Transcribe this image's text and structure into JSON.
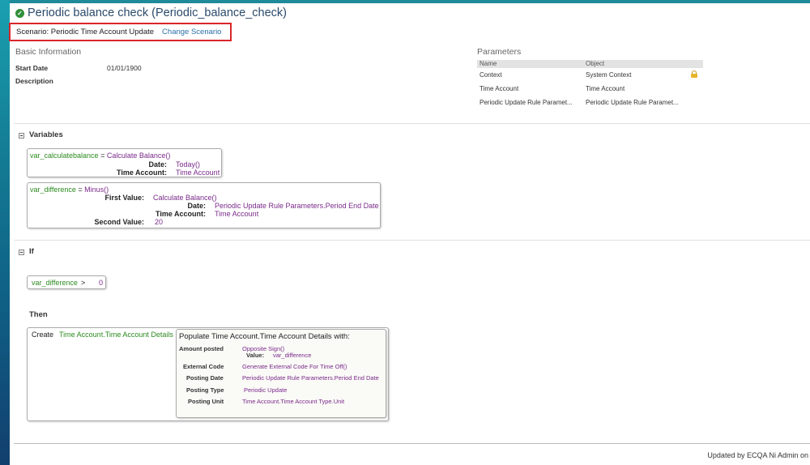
{
  "header": {
    "title": "Periodic balance check (Periodic_balance_check)",
    "status_icon": "check-circle-icon"
  },
  "scenario": {
    "label": "Scenario: Periodic Time Account Update",
    "change_link": "Change Scenario"
  },
  "basic_info": {
    "heading": "Basic Information",
    "start_date_label": "Start Date",
    "start_date_value": "01/01/1900",
    "description_label": "Description"
  },
  "parameters": {
    "heading": "Parameters",
    "columns": [
      "Name",
      "Object"
    ],
    "rows": [
      {
        "name": "Context",
        "object": "System Context",
        "locked": true
      },
      {
        "name": "Time Account",
        "object": "Time Account",
        "locked": false
      },
      {
        "name": "Periodic Update Rule Paramet...",
        "object": "Periodic Update Rule Paramet...",
        "locked": false
      }
    ]
  },
  "variables": {
    "title": "Variables",
    "var1": {
      "name": "var_calculatebalance",
      "eq": "=",
      "func": "Calculate Balance()",
      "date_label": "Date:",
      "date_value": "Today()",
      "account_label": "Time Account:",
      "account_value": "Time Account"
    },
    "var2": {
      "name": "var_difference",
      "eq": "=",
      "func": "Minus()",
      "first_label": "First Value:",
      "first_value": "Calculate Balance()",
      "date_label": "Date:",
      "date_value": "Periodic Update Rule Parameters.Period End Date",
      "account_label": "Time Account:",
      "account_value": "Time Account",
      "second_label": "Second Value:",
      "second_value": "20"
    }
  },
  "if_section": {
    "title": "If",
    "condition_var": "var_difference",
    "condition_op": ">",
    "condition_value": "0"
  },
  "then_section": {
    "title": "Then",
    "create_label": "Create",
    "create_target": "Time Account.Time Account Details",
    "populate_title": "Populate Time Account.Time Account Details with:",
    "fields": [
      {
        "label": "Amount posted",
        "value": "Opposite Sign()"
      },
      {
        "label": "Value:",
        "value": "var_difference"
      },
      {
        "label": "External Code",
        "value": "Generate External Code For Time Off()"
      },
      {
        "label": "Posting Date",
        "value": "Periodic Update Rule Parameters.Period End Date"
      },
      {
        "label": "Posting Type",
        "value": "Periodic Update"
      },
      {
        "label": "Posting Unit",
        "value": "Time Account.Time Account Type.Unit"
      }
    ]
  },
  "footer": {
    "text": "Updated by ECQA Ni Admin on"
  }
}
